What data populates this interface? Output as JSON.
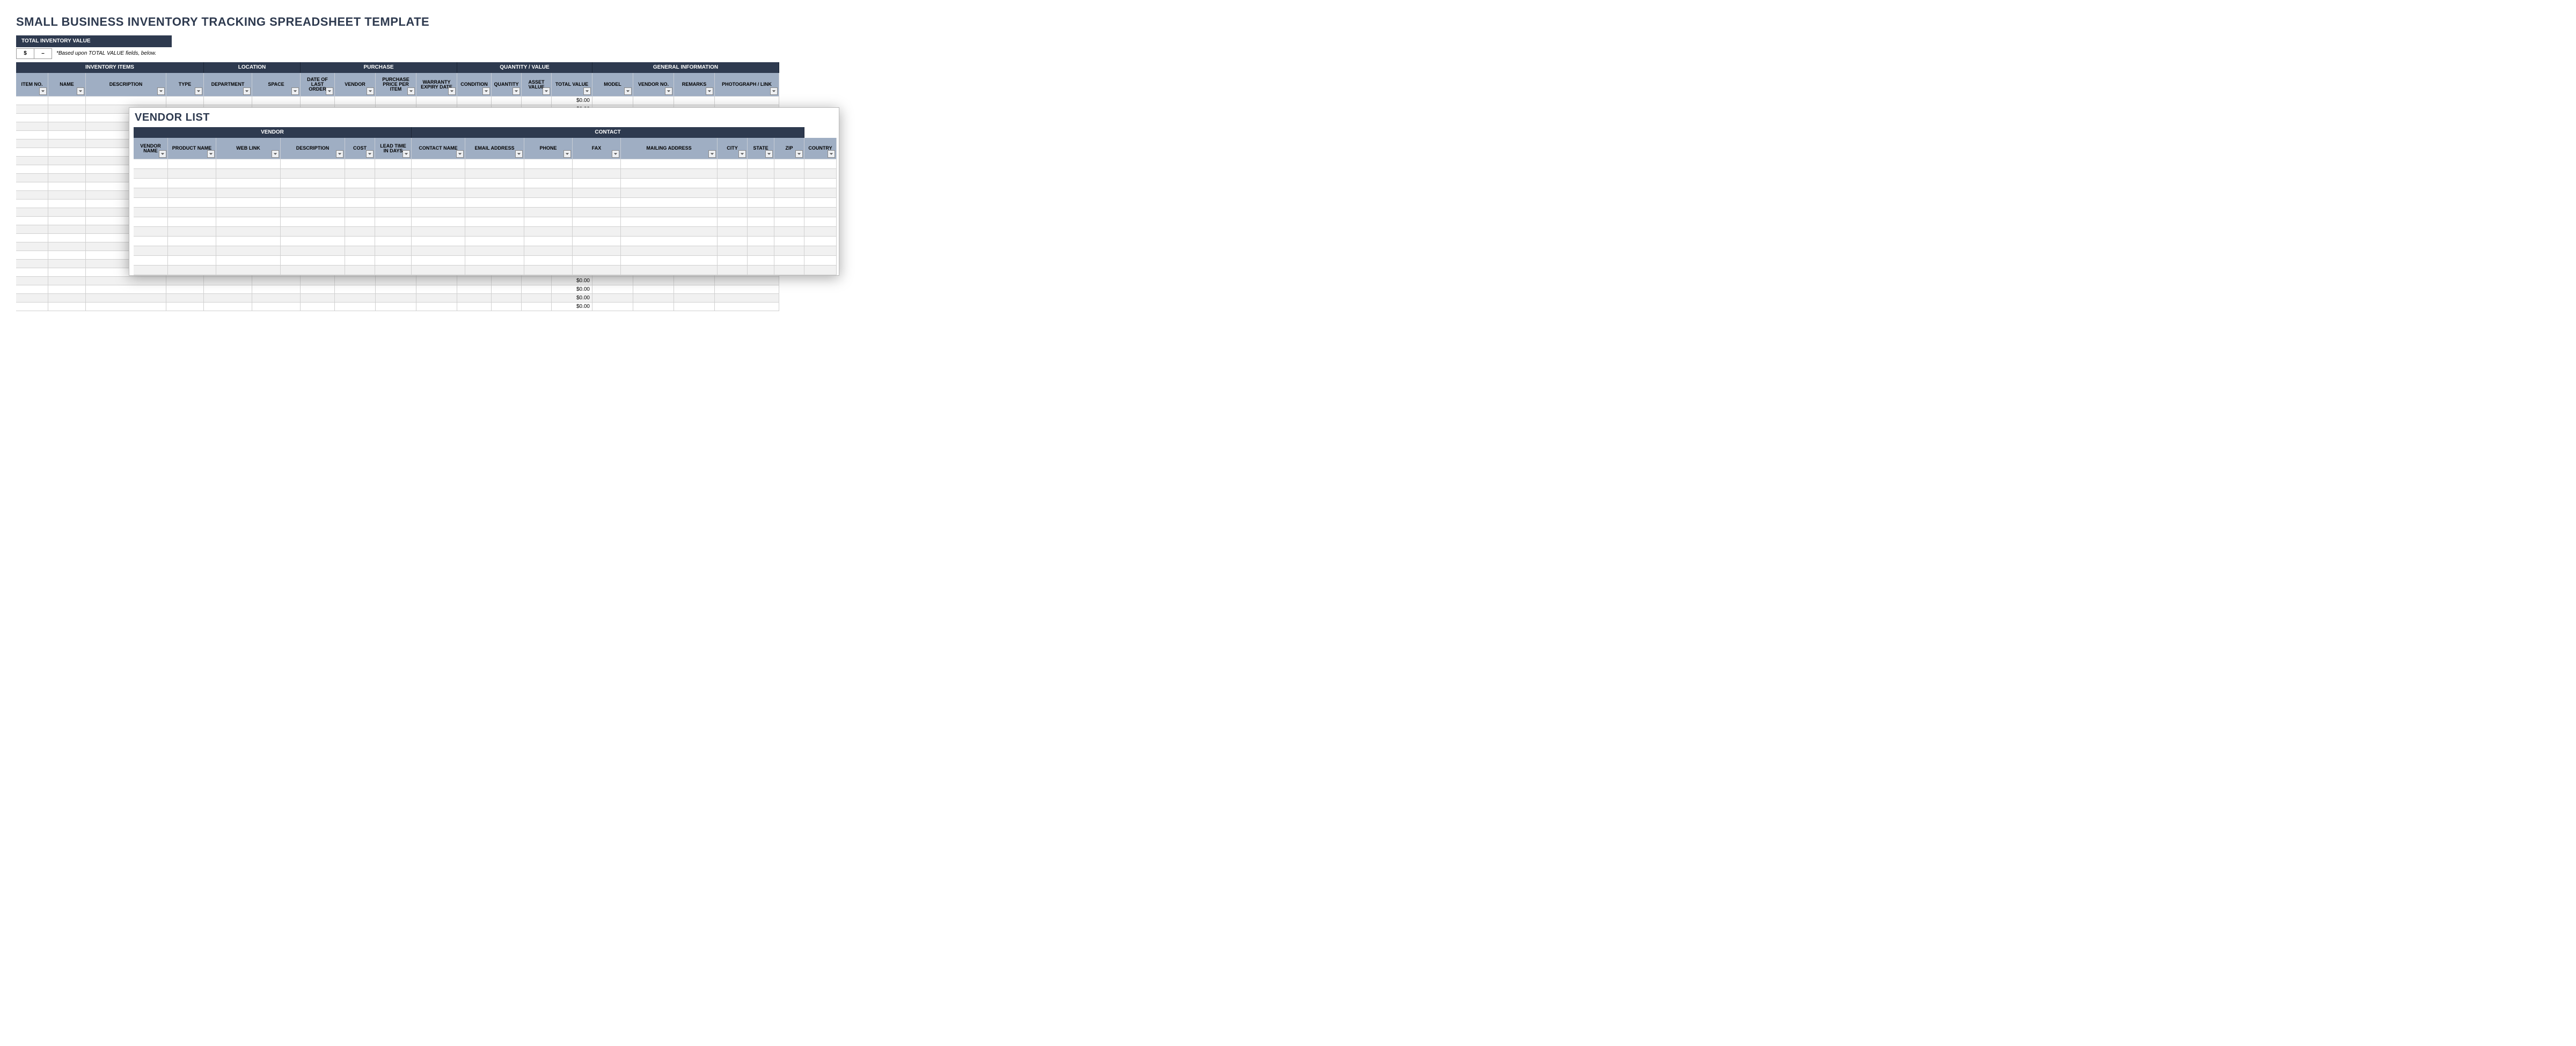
{
  "title": "SMALL BUSINESS INVENTORY TRACKING SPREADSHEET TEMPLATE",
  "total_inventory": {
    "label": "TOTAL INVENTORY VALUE",
    "currency": "$",
    "value": "–",
    "note": "*Based upon TOTAL VALUE fields, below."
  },
  "inventory_groups": [
    {
      "label": "INVENTORY ITEMS",
      "span": 4
    },
    {
      "label": "LOCATION",
      "span": 2
    },
    {
      "label": "PURCHASE",
      "span": 4
    },
    {
      "label": "QUANTITY / VALUE",
      "span": 4
    },
    {
      "label": "GENERAL INFORMATION",
      "span": 4
    }
  ],
  "inventory_columns": [
    {
      "label": "ITEM NO.",
      "w": 60
    },
    {
      "label": "NAME",
      "w": 70
    },
    {
      "label": "DESCRIPTION",
      "w": 150
    },
    {
      "label": "TYPE",
      "w": 70
    },
    {
      "label": "DEPARTMENT",
      "w": 90
    },
    {
      "label": "SPACE",
      "w": 90
    },
    {
      "label": "DATE OF LAST ORDER",
      "w": 64
    },
    {
      "label": "VENDOR",
      "w": 76
    },
    {
      "label": "PURCHASE PRICE PER ITEM",
      "w": 76
    },
    {
      "label": "WARRANTY EXPIRY DATE",
      "w": 76
    },
    {
      "label": "CONDITION",
      "w": 64
    },
    {
      "label": "QUANTITY",
      "w": 56
    },
    {
      "label": "ASSET VALUE",
      "w": 56
    },
    {
      "label": "TOTAL VALUE",
      "w": 76
    },
    {
      "label": "MODEL",
      "w": 76
    },
    {
      "label": "VENDOR NO.",
      "w": 76
    },
    {
      "label": "REMARKS",
      "w": 76
    },
    {
      "label": "PHOTOGRAPH / LINK",
      "w": 120
    }
  ],
  "inventory_rows": [
    {
      "total_value": "$0.00"
    },
    {
      "total_value": "$0.00"
    },
    {
      "total_value": "$0.00"
    },
    {
      "total_value": ""
    },
    {
      "total_value": ""
    },
    {
      "total_value": ""
    },
    {
      "total_value": ""
    },
    {
      "total_value": ""
    },
    {
      "total_value": ""
    },
    {
      "total_value": ""
    },
    {
      "total_value": ""
    },
    {
      "total_value": ""
    },
    {
      "total_value": ""
    },
    {
      "total_value": ""
    },
    {
      "total_value": ""
    },
    {
      "total_value": ""
    },
    {
      "total_value": ""
    },
    {
      "total_value": ""
    },
    {
      "total_value": ""
    },
    {
      "total_value": ""
    },
    {
      "total_value": "$0.00"
    },
    {
      "total_value": "$0.00"
    },
    {
      "total_value": "$0.00"
    },
    {
      "total_value": "$0.00"
    },
    {
      "total_value": "$0.00"
    }
  ],
  "vendor_list": {
    "title": "VENDOR LIST",
    "groups": [
      {
        "label": "VENDOR",
        "span": 6
      },
      {
        "label": "CONTACT",
        "span": 8
      }
    ],
    "columns": [
      {
        "label": "VENDOR NAME",
        "w": 64
      },
      {
        "label": "PRODUCT NAME",
        "w": 90
      },
      {
        "label": "WEB LINK",
        "w": 120
      },
      {
        "label": "DESCRIPTION",
        "w": 120
      },
      {
        "label": "COST",
        "w": 56
      },
      {
        "label": "LEAD TIME IN DAYS",
        "w": 68
      },
      {
        "label": "CONTACT NAME",
        "w": 100
      },
      {
        "label": "EMAIL ADDRESS",
        "w": 110
      },
      {
        "label": "PHONE",
        "w": 90
      },
      {
        "label": "FAX",
        "w": 90
      },
      {
        "label": "MAILING ADDRESS",
        "w": 180
      },
      {
        "label": "CITY",
        "w": 56
      },
      {
        "label": "STATE",
        "w": 50
      },
      {
        "label": "ZIP",
        "w": 56
      },
      {
        "label": "COUNTRY",
        "w": 60
      }
    ],
    "row_count": 12
  }
}
